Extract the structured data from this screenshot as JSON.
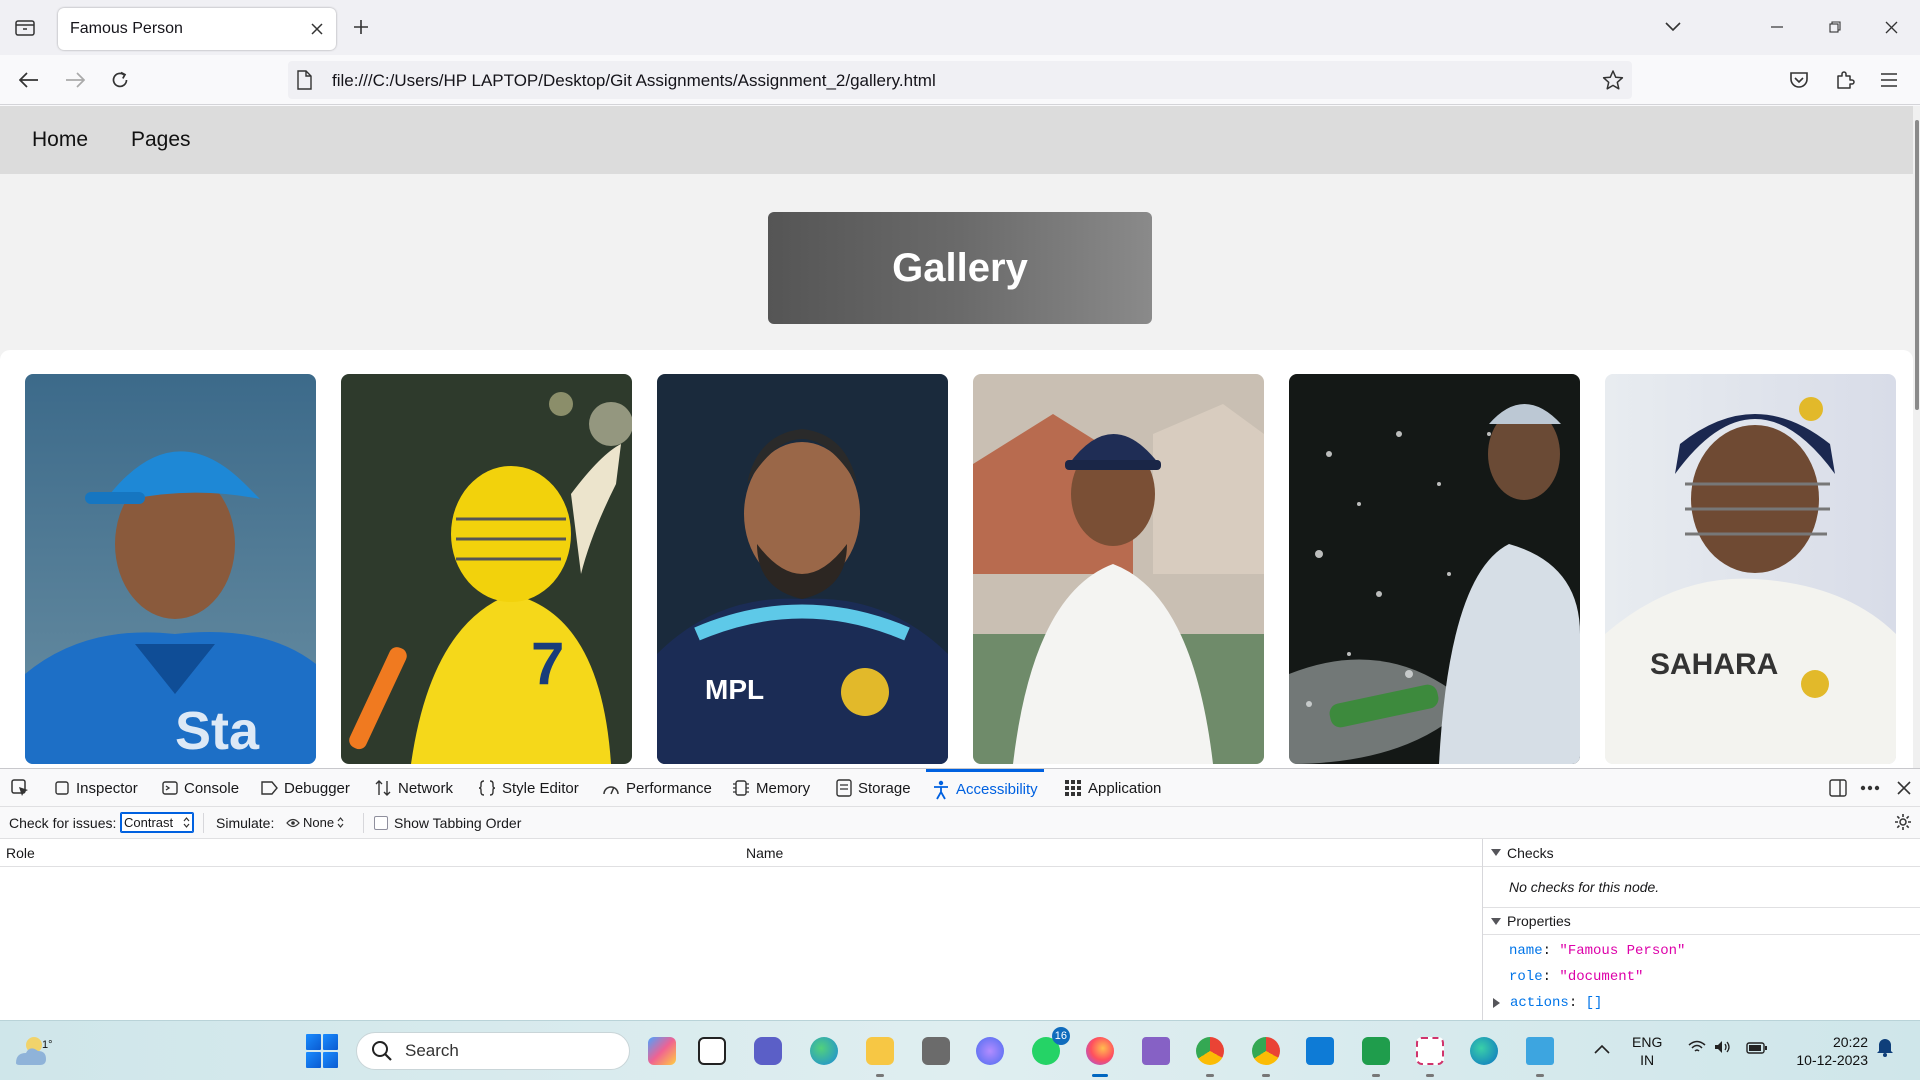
{
  "browser": {
    "tab_title": "Famous Person",
    "url": "file:///C:/Users/HP LAPTOP/Desktop/Git Assignments/Assignment_2/gallery.html"
  },
  "site": {
    "nav": [
      "Home",
      "Pages"
    ],
    "banner_title": "Gallery",
    "photos": [
      "ms-dhoni-blue-cap",
      "ms-dhoni-yellow-helmet",
      "ms-dhoni-portrait",
      "ms-dhoni-white-kit",
      "ms-dhoni-champagne",
      "ms-dhoni-sahara-helmet"
    ]
  },
  "devtools": {
    "tabs": [
      "Inspector",
      "Console",
      "Debugger",
      "Network",
      "Style Editor",
      "Performance",
      "Memory",
      "Storage",
      "Accessibility",
      "Application"
    ],
    "active_tab": "Accessibility",
    "check_for_issues_label": "Check for issues:",
    "check_for_issues_value": "Contrast",
    "simulate_label": "Simulate:",
    "simulate_value": "None",
    "show_tabbing_order": "Show Tabbing Order",
    "columns": {
      "role": "Role",
      "name": "Name"
    },
    "checks_title": "Checks",
    "checks_message": "No checks for this node.",
    "properties_title": "Properties",
    "properties": {
      "name_key": "name",
      "name_value": "\"Famous Person\"",
      "role_key": "role",
      "role_value": "\"document\"",
      "actions_key": "actions",
      "actions_value": "[]"
    }
  },
  "taskbar": {
    "weather_temp": "1°",
    "search_placeholder": "Search",
    "whatsapp_badge": "16",
    "language_line1": "ENG",
    "language_line2": "IN",
    "time": "20:22",
    "date": "10-12-2023"
  },
  "colors": {
    "accent": "#0061e0",
    "site_nav_bg": "#dcdcdc",
    "banner_bg": "#666666"
  }
}
